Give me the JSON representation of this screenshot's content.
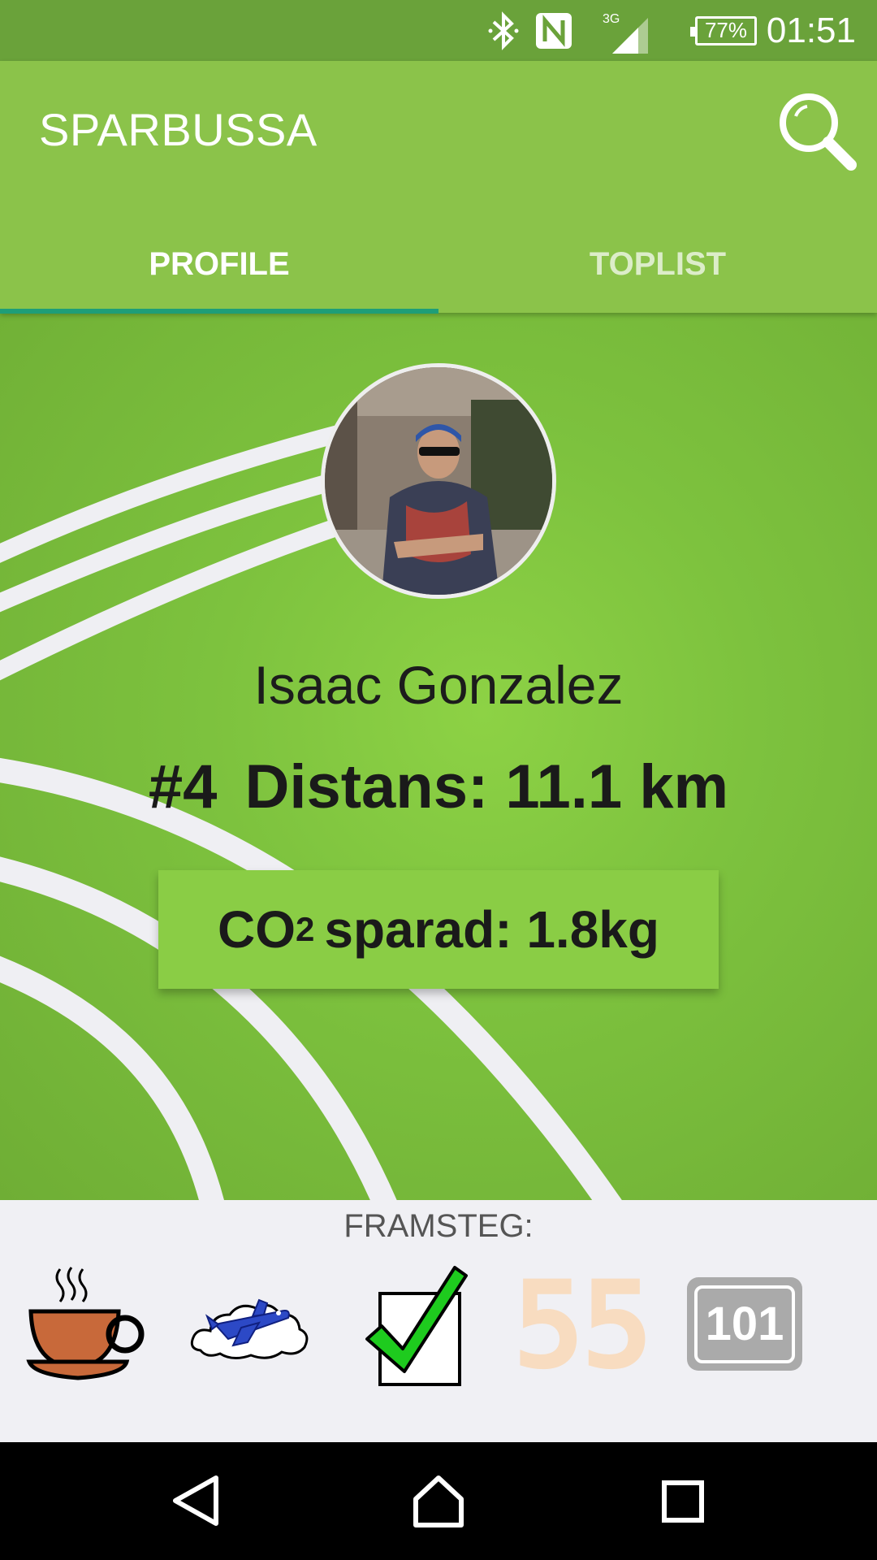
{
  "status_bar": {
    "network": "3G",
    "battery": "77%",
    "time": "01:51"
  },
  "app_bar": {
    "title": "SPARBUSSA",
    "tabs": [
      {
        "label": "PROFILE",
        "selected": true
      },
      {
        "label": "TOPLIST",
        "selected": false
      }
    ]
  },
  "profile": {
    "name": "Isaac Gonzalez",
    "rank": "#4",
    "distance": "Distans: 11.1 km",
    "co2_prefix": "CO",
    "co2_subscript": "2",
    "co2_value": "sparad: 1.8kg"
  },
  "achievements": {
    "label": "FRAMSTEG:",
    "badges": [
      {
        "icon": "coffee-cup-icon",
        "unlocked": true
      },
      {
        "icon": "airplane-cloud-icon",
        "unlocked": true
      },
      {
        "icon": "checkbox-check-icon",
        "unlocked": true
      },
      {
        "icon": "number-55-icon",
        "text": "55",
        "unlocked": false
      },
      {
        "icon": "route-101-sign-icon",
        "text": "101",
        "unlocked": true
      }
    ]
  },
  "colors": {
    "status_bar": "#6aa23a",
    "app_bar": "#8bc34a",
    "tab_indicator": "#1e9e78",
    "co2_card": "#8acd45"
  }
}
